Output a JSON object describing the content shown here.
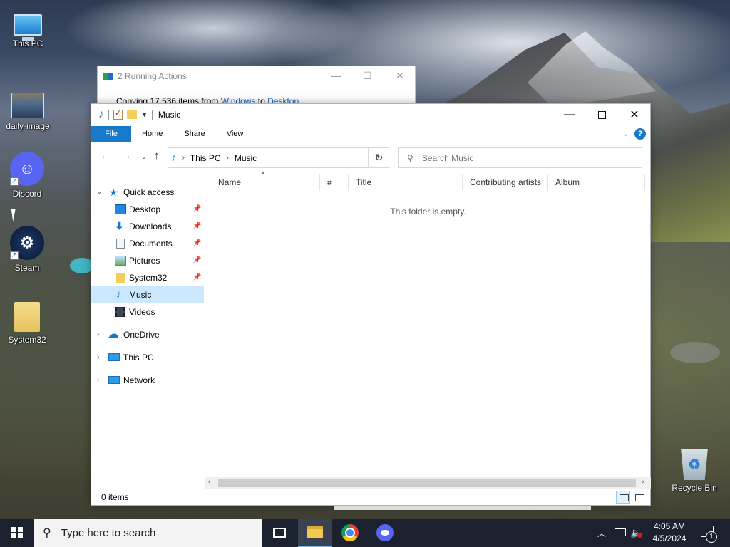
{
  "desktop": {
    "icons": [
      {
        "label": "This PC",
        "icon": "monitor-icon"
      },
      {
        "label": "daily-image",
        "icon": "image-file-icon"
      },
      {
        "label": "Discord",
        "icon": "discord-icon"
      },
      {
        "label": "Steam",
        "icon": "steam-icon"
      },
      {
        "label": "System32",
        "icon": "folder-icon"
      },
      {
        "label": "Recycle Bin",
        "icon": "recycle-bin-icon"
      }
    ]
  },
  "running_actions": {
    "title": "2 Running Actions",
    "line_prefix": "Copying 17.536 items from ",
    "source": "Windows",
    "to_word": " to ",
    "destination": "Desktop"
  },
  "explorer": {
    "title": "Music",
    "ribbon_tabs": [
      "File",
      "Home",
      "Share",
      "View"
    ],
    "breadcrumb": [
      "This PC",
      "Music"
    ],
    "search_placeholder": "Search Music",
    "columns": [
      "Name",
      "#",
      "Title",
      "Contributing artists",
      "Album"
    ],
    "empty_message": "This folder is empty.",
    "status": "0 items",
    "nav": {
      "quick_access": "Quick access",
      "items": [
        {
          "label": "Desktop",
          "pinned": true
        },
        {
          "label": "Downloads",
          "pinned": true
        },
        {
          "label": "Documents",
          "pinned": true
        },
        {
          "label": "Pictures",
          "pinned": true
        },
        {
          "label": "System32",
          "pinned": true
        },
        {
          "label": "Music",
          "pinned": false
        },
        {
          "label": "Videos",
          "pinned": false
        }
      ],
      "onedrive": "OneDrive",
      "this_pc": "This PC",
      "network": "Network"
    }
  },
  "taskbar": {
    "search_placeholder": "Type here to search",
    "time": "4:05 AM",
    "date": "4/5/2024",
    "notification_count": "1"
  },
  "colors": {
    "accent": "#1979ca",
    "selection": "#cce8ff",
    "taskbar": "#1c2130"
  }
}
